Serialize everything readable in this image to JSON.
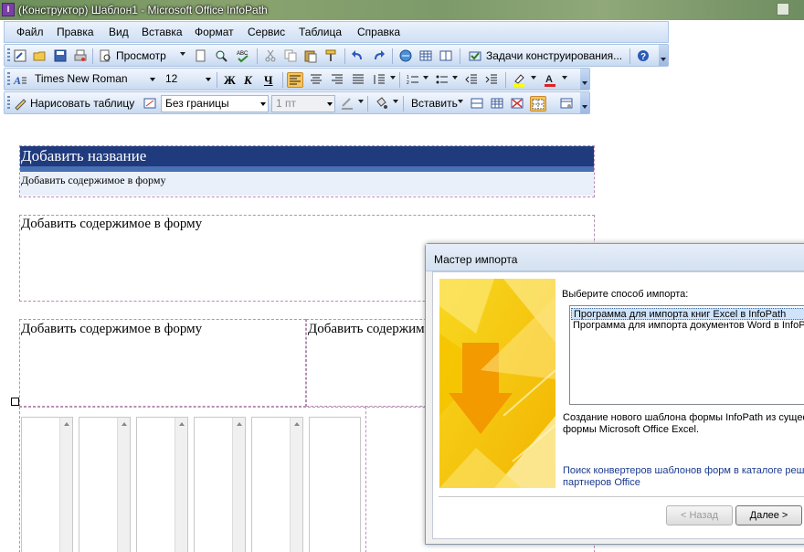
{
  "window": {
    "title": "(Конструктор) Шаблон1 - Microsoft Office InfoPath",
    "app_icon": "infopath-icon"
  },
  "menu": [
    {
      "label": "Файл"
    },
    {
      "label": "Правка"
    },
    {
      "label": "Вид"
    },
    {
      "label": "Вставка"
    },
    {
      "label": "Формат"
    },
    {
      "label": "Сервис"
    },
    {
      "label": "Таблица"
    },
    {
      "label": "Справка"
    }
  ],
  "standard_toolbar": {
    "preview_label": "Просмотр",
    "design_tasks_label": "Задачи конструирования..."
  },
  "format_toolbar": {
    "font_name": "Times New Roman",
    "font_size": "12",
    "bold": "Ж",
    "italic": "К",
    "underline": "Ч"
  },
  "table_toolbar": {
    "draw_table_label": "Нарисовать таблицу",
    "border_style": "Без границы",
    "border_width": "1 пт",
    "insert_label": "Вставить"
  },
  "form": {
    "title_placeholder": "Добавить название",
    "subtitle_placeholder": "Добавить содержимое в форму",
    "section1_placeholder": "Добавить содержимое в форму",
    "section2_left_placeholder": "Добавить содержимое в форму",
    "section2_right_placeholder": "Добавить содержим"
  },
  "dialog": {
    "title": "Мастер импорта",
    "prompt": "Выберите способ импорта:",
    "options": [
      {
        "label": "Программа для импорта книг Excel в InfoPath",
        "selected": true
      },
      {
        "label": "Программа для импорта документов Word в InfoPath",
        "selected": false
      }
    ],
    "description_line1": "Создание нового шаблона формы InfoPath из сущест",
    "description_line2": "формы Microsoft Office Excel.",
    "link_line1": "Поиск конвертеров шаблонов форм в каталоге решен",
    "link_line2": "партнеров Office",
    "back_button": "< Назад",
    "next_button": "Далее >"
  },
  "colors": {
    "header_band": "#1f3b7d",
    "header_stripe": "#4a70b4",
    "selection": "#cfe3fb",
    "wizard_art": "#f5c400"
  }
}
